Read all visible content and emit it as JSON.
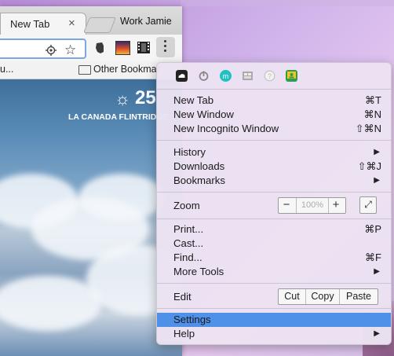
{
  "browser": {
    "tab_title": "New Tab",
    "tab_close": "×",
    "profile_name": "Work Jamie",
    "bookmarks_truncated": "u...",
    "bookmarks_other": "Other Bookmar",
    "weather_temp": "25",
    "weather_location": "LA CANADA FLINTRIDGE"
  },
  "menu": {
    "extensions": [
      {
        "icon": "cloud-extension-icon",
        "color": "#222222"
      },
      {
        "icon": "power-extension-icon",
        "color": "#888888"
      },
      {
        "icon": "m-extension-icon",
        "color": "#20c2c0"
      },
      {
        "icon": "grid-extension-icon",
        "color": "#999999"
      },
      {
        "icon": "help-extension-icon",
        "color": "#bbbbbb"
      },
      {
        "icon": "classroom-extension-icon",
        "color": "#2e9e4a"
      }
    ],
    "new_tab": {
      "label": "New Tab",
      "shortcut": "⌘T"
    },
    "new_window": {
      "label": "New Window",
      "shortcut": "⌘N"
    },
    "new_incognito": {
      "label": "New Incognito Window",
      "shortcut": "⇧⌘N"
    },
    "history": {
      "label": "History"
    },
    "downloads": {
      "label": "Downloads",
      "shortcut": "⇧⌘J"
    },
    "bookmarks": {
      "label": "Bookmarks"
    },
    "zoom": {
      "label": "Zoom",
      "minus": "−",
      "value": "100%",
      "plus": "+",
      "fullscreen": "⤢"
    },
    "print": {
      "label": "Print...",
      "shortcut": "⌘P"
    },
    "cast": {
      "label": "Cast..."
    },
    "find": {
      "label": "Find...",
      "shortcut": "⌘F"
    },
    "more_tools": {
      "label": "More Tools"
    },
    "edit": {
      "label": "Edit",
      "cut": "Cut",
      "copy": "Copy",
      "paste": "Paste"
    },
    "settings": {
      "label": "Settings"
    },
    "help": {
      "label": "Help"
    },
    "submenu_arrow": "▶"
  }
}
